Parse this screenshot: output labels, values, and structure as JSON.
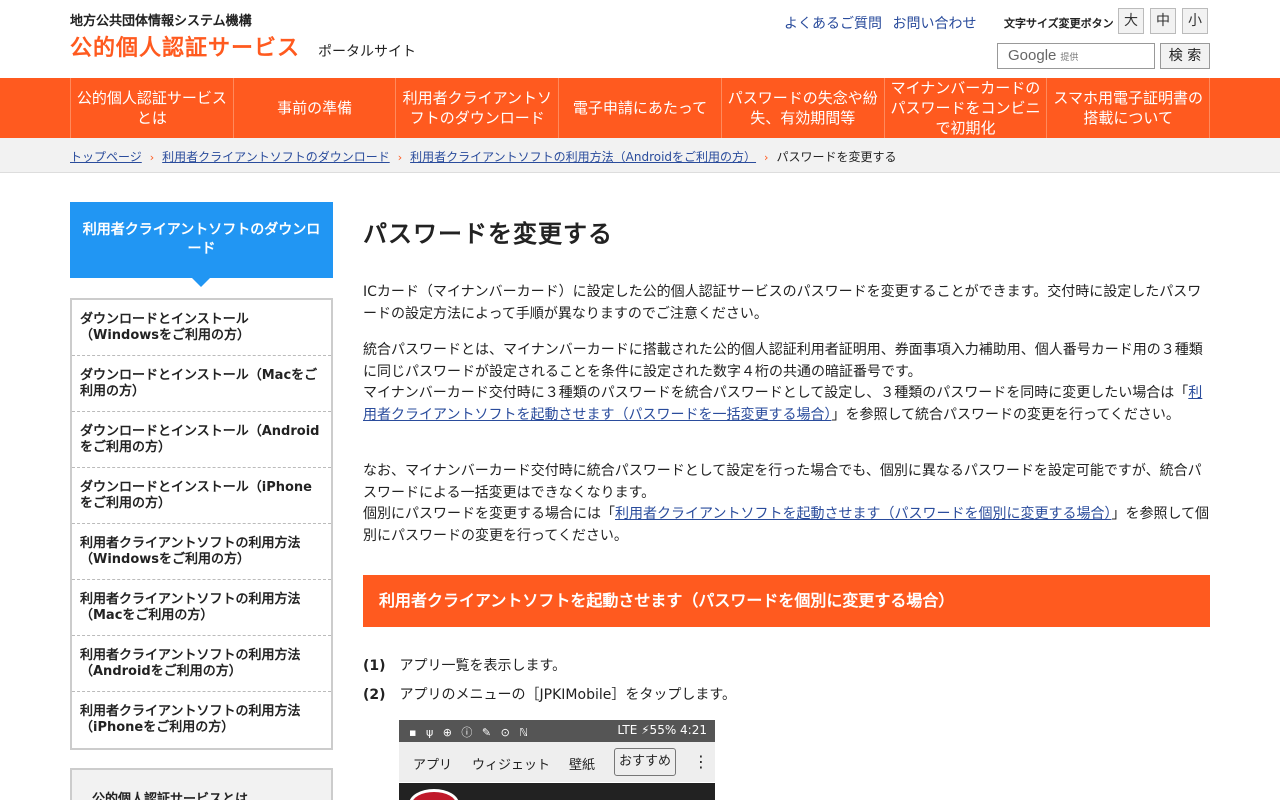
{
  "header": {
    "org": "地方公共団体情報システム機構",
    "site_title": "公的個人認証サービス",
    "site_sub": "ポータルサイト",
    "faq": "よくあるご質問",
    "contact": "お問い合わせ",
    "font_size_label": "文字サイズ変更ボタン",
    "font_large": "大",
    "font_medium": "中",
    "font_small": "小",
    "search_brand": "Google",
    "search_provided": "提供",
    "search_button": "検 索"
  },
  "nav": {
    "items": [
      "公的個人認証サービスとは",
      "事前の準備",
      "利用者クライアントソフトのダウンロード",
      "電子申請にあたって",
      "パスワードの失念や紛失、有効期間等",
      "マイナンバーカードのパスワードをコンビニで初期化",
      "スマホ用電子証明書の搭載について"
    ]
  },
  "breadcrumb": {
    "items": [
      "トップページ",
      "利用者クライアントソフトのダウンロード",
      "利用者クライアントソフトの利用方法（Androidをご利用の方）"
    ],
    "current": "パスワードを変更する",
    "separator": "›"
  },
  "sidebar": {
    "heading": "利用者クライアントソフトのダウンロード",
    "items": [
      "ダウンロードとインストール（Windowsをご利用の方）",
      "ダウンロードとインストール（Macをご利用の方）",
      "ダウンロードとインストール（Androidをご利用の方）",
      "ダウンロードとインストール（iPhoneをご利用の方）",
      "利用者クライアントソフトの利用方法（Windowsをご利用の方）",
      "利用者クライアントソフトの利用方法（Macをご利用の方）",
      "利用者クライアントソフトの利用方法（Androidをご利用の方）",
      "利用者クライアントソフトの利用方法（iPhoneをご利用の方）"
    ],
    "next_heading": "公的個人認証サービスとは"
  },
  "main": {
    "title": "パスワードを変更する",
    "p1": "ICカード（マイナンバーカード）に設定した公的個人認証サービスのパスワードを変更することができます。交付時に設定したパスワードの設定方法によって手順が異なりますのでご注意ください。",
    "p2a": "統合パスワードとは、マイナンバーカードに搭載された公的個人認証利用者証明用、券面事項入力補助用、個人番号カード用の３種類に同じパスワードが設定されることを条件に設定された数字４桁の共通の暗証番号です。",
    "p2b_pre": "マイナンバーカード交付時に３種類のパスワードを統合パスワードとして設定し、３種類のパスワードを同時に変更したい場合は「",
    "p2b_link": "利用者クライアントソフトを起動させます（パスワードを一括変更する場合）",
    "p2b_post": "」を参照して統合パスワードの変更を行ってください。",
    "p3a": "なお、マイナンバーカード交付時に統合パスワードとして設定を行った場合でも、個別に異なるパスワードを設定可能ですが、統合パスワードによる一括変更はできなくなります。",
    "p3b_pre": "個別にパスワードを変更する場合には「",
    "p3b_link": "利用者クライアントソフトを起動させます（パスワードを個別に変更する場合）",
    "p3b_post": "」を参照して個別にパスワードの変更を行ってください。",
    "section": "利用者クライアントソフトを起動させます（パスワードを個別に変更する場合）",
    "steps": [
      {
        "num": "(1)",
        "text": "アプリ一覧を表示します。"
      },
      {
        "num": "(2)",
        "text": "アプリのメニューの［JPKIMobile］をタップします。"
      }
    ]
  },
  "phone": {
    "status_left": "▪ ψ ⊕ ⓘ ✎ ⊙ ℕ",
    "status_right": "LTE ⚡55% 4:21",
    "tabs": [
      "アプリ",
      "ウィジェット",
      "壁紙",
      "おすすめ"
    ],
    "more": "⋮"
  },
  "colors": {
    "accent": "#ff5a1f",
    "sidebar_head": "#2196f3",
    "link": "#2a4c9c"
  }
}
